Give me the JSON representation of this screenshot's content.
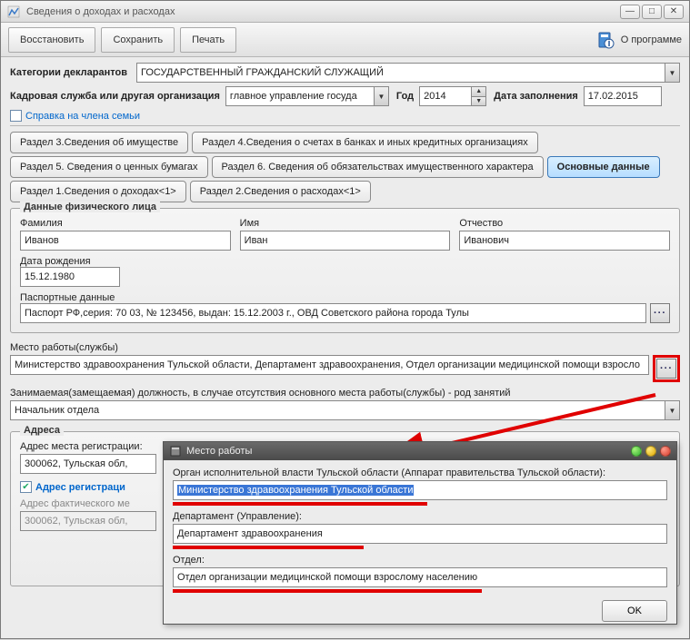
{
  "window": {
    "title": "Сведения о доходах и расходах"
  },
  "toolbar": {
    "restore": "Восстановить",
    "save": "Сохранить",
    "print": "Печать",
    "about": "О программе"
  },
  "header": {
    "categories_label": "Категории декларантов",
    "categories_value": "ГОСУДАРСТВЕННЫЙ ГРАЖДАНСКИЙ СЛУЖАЩИЙ",
    "org_label": "Кадровая служба или другая организация",
    "org_value": "главное управление госуда",
    "year_label": "Год",
    "year_value": "2014",
    "fill_date_label": "Дата заполнения",
    "fill_date_value": "17.02.2015",
    "family_ref": "Справка на члена семьи"
  },
  "tabs": {
    "t1": "Раздел 3.Сведения об имуществе",
    "t2": "Раздел 4.Сведения о счетах в банках и иных кредитных организациях",
    "t3": "Раздел 5. Сведения о ценных бумагах",
    "t4": "Раздел 6. Сведения об обязательствах имущественного характера",
    "t5": "Основные данные",
    "t6": "Раздел 1.Сведения о доходах<1>",
    "t7": "Раздел 2.Сведения о расходах<1>"
  },
  "person": {
    "group_title": "Данные физического лица",
    "lastname_label": "Фамилия",
    "lastname": "Иванов",
    "firstname_label": "Имя",
    "firstname": "Иван",
    "patronym_label": "Отчество",
    "patronym": "Иванович",
    "dob_label": "Дата рождения",
    "dob": "15.12.1980",
    "passport_label": "Паспортные данные",
    "passport": "Паспорт РФ,серия: 70 03, № 123456, выдан: 15.12.2003 г., ОВД Советского района города Тулы"
  },
  "work": {
    "place_label": "Место работы(службы)",
    "place": "Министерство здравоохранения Тульской области, Департамент здравоохранения, Отдел организации медицинской помощи взросло",
    "position_label": "Занимаемая(замещаемая) должность, в случае отсутствия основного места работы(службы) - род занятий",
    "position": "Начальник отдела"
  },
  "addresses": {
    "group_title": "Адреса",
    "reg_label": "Адрес места регистрации:",
    "reg_value": "300062, Тульская обл,",
    "same_label": "Адрес регистраци",
    "fact_label": "Адрес фактического ме",
    "fact_value": "300062, Тульская обл,"
  },
  "dialog": {
    "title": "Место работы",
    "organ_label": "Орган исполнительной власти Тульской области (Аппарат правительства Тульской области):",
    "organ_value": "Министерство здравоохранения Тульской области",
    "dept_label": "Департамент (Управление):",
    "dept_value": "Департамент здравоохранения",
    "otdel_label": "Отдел:",
    "otdel_value": "Отдел организации медицинской помощи взрослому населению",
    "ok": "OK"
  }
}
